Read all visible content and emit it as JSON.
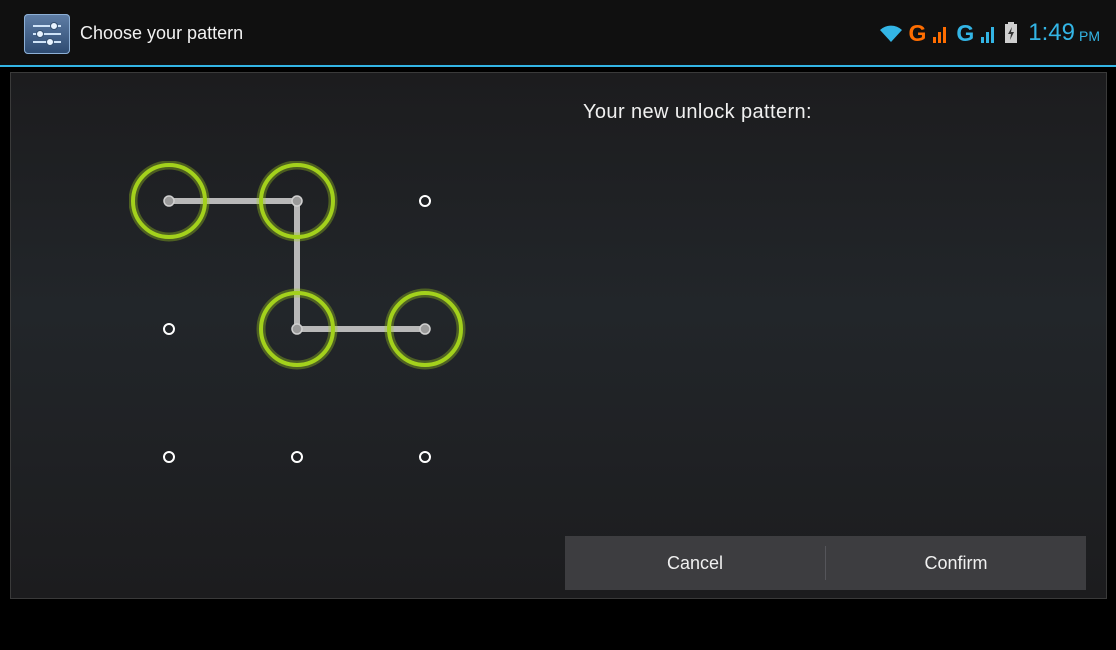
{
  "app": {
    "title": "Choose your pattern",
    "icon": "settings-sliders-icon"
  },
  "status_bar": {
    "wifi_icon": "wifi-icon",
    "network_1": "G",
    "network_2": "G",
    "signal_icon": "signal-icon",
    "battery_icon": "battery-charging-icon",
    "time": "1:49",
    "ampm": "PM",
    "colors": {
      "accent": "#33b5e5",
      "orange": "#ff6d00"
    }
  },
  "lock_pattern": {
    "header": "Your new unlock pattern:",
    "grid_size": 3,
    "selected_sequence": [
      1,
      2,
      5,
      6
    ],
    "colors": {
      "ring": "#a3d11c",
      "line": "#b8b8b8",
      "dot": "#ffffff"
    }
  },
  "buttons": {
    "cancel": "Cancel",
    "confirm": "Confirm"
  }
}
